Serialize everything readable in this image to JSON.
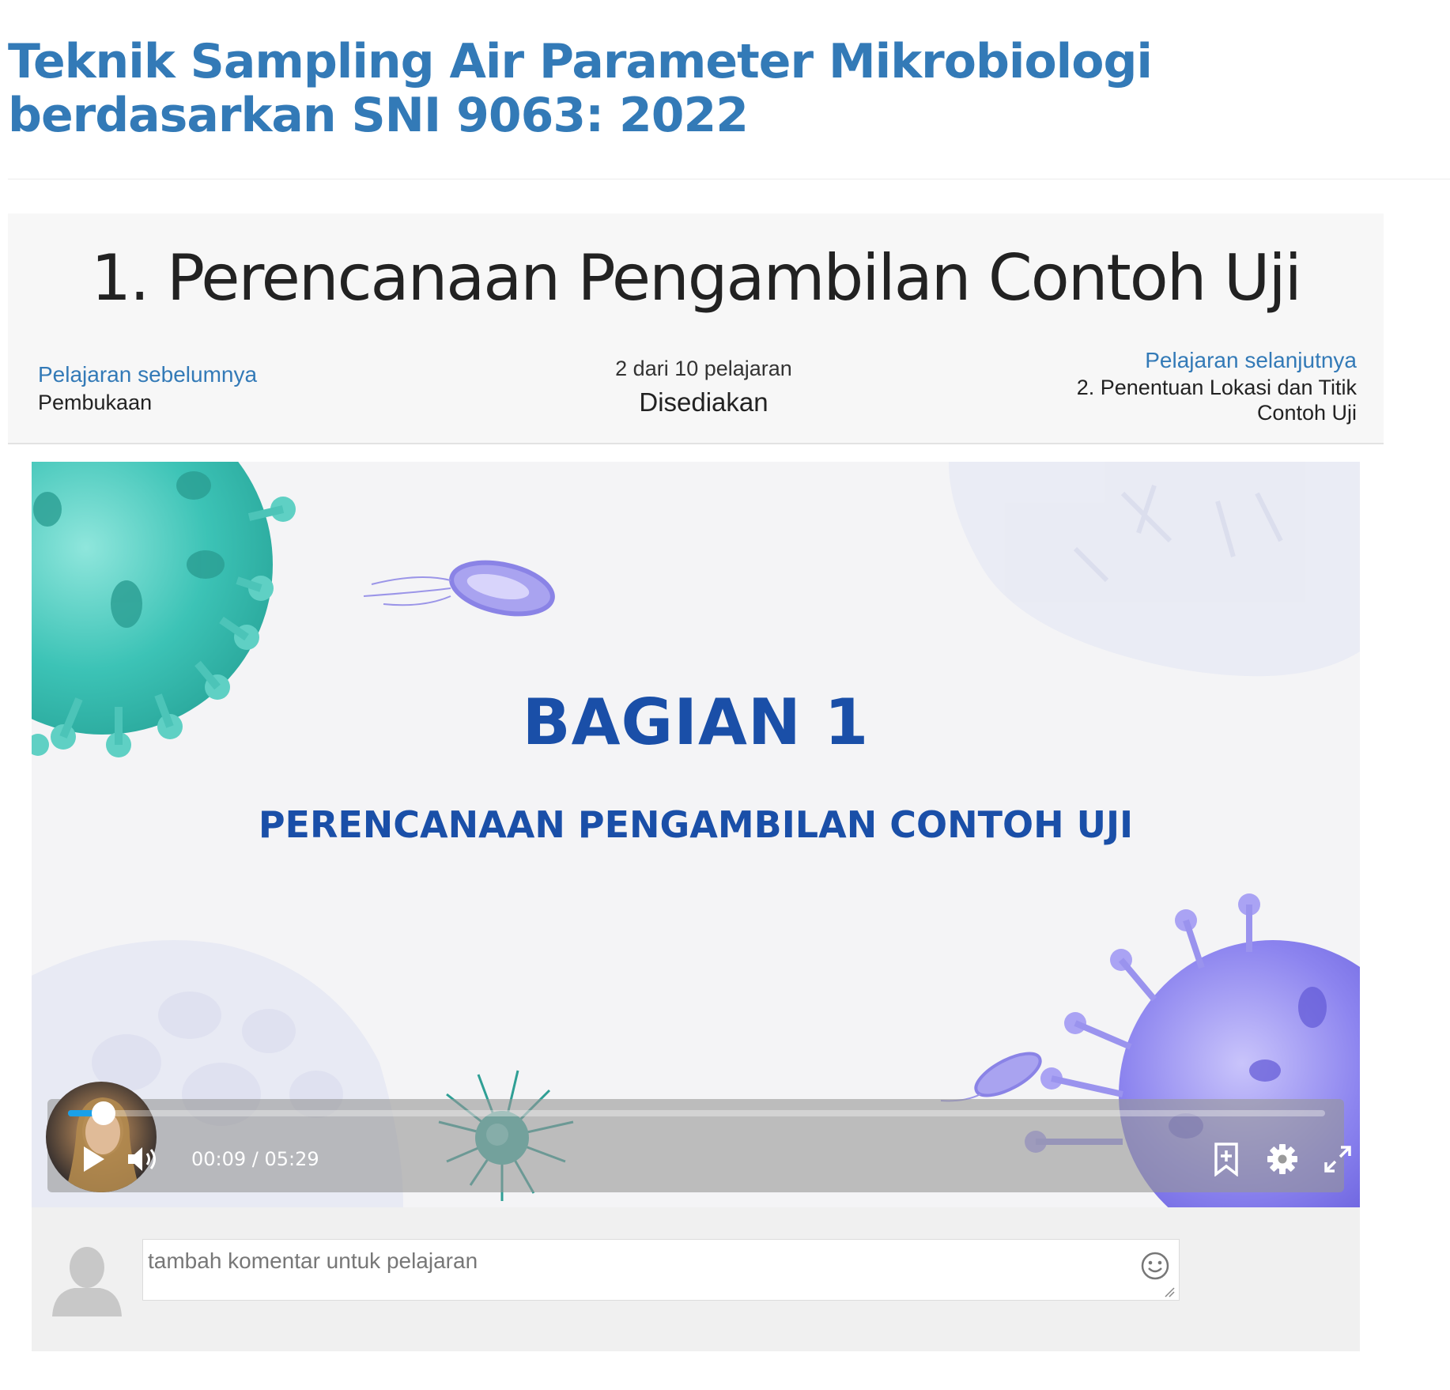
{
  "course": {
    "title": "Teknik Sampling Air Parameter Mikrobiologi berdasarkan SNI 9063: 2022"
  },
  "lesson": {
    "title": "1. Perencanaan Pengambilan Contoh Uji",
    "prev_label": "Pelajaran sebelumnya",
    "prev_name": "Pembukaan",
    "count": "2 dari 10 pelajaran",
    "status": "Disediakan",
    "next_label": "Pelajaran selanjutnya",
    "next_name": "2. Penentuan Lokasi dan Titik Contoh Uji"
  },
  "video": {
    "slide_heading": "BAGIAN 1",
    "slide_subheading": "PERENCANAAN PENGAMBILAN CONTOH UJI",
    "time": "00:09 / 05:29",
    "progress": 0.028
  },
  "comment": {
    "placeholder": "tambah komentar untuk pelajaran"
  },
  "icons": {
    "play": "play-icon",
    "volume": "volume-icon",
    "bookmark": "bookmark-add-icon",
    "settings": "gear-icon",
    "fullscreen": "fullscreen-icon",
    "emoji": "emoji-icon",
    "avatar": "user-avatar-icon"
  },
  "colors": {
    "link": "#337ab7",
    "slide_text": "#1a4fa8",
    "progress": "#1aa0e8"
  }
}
